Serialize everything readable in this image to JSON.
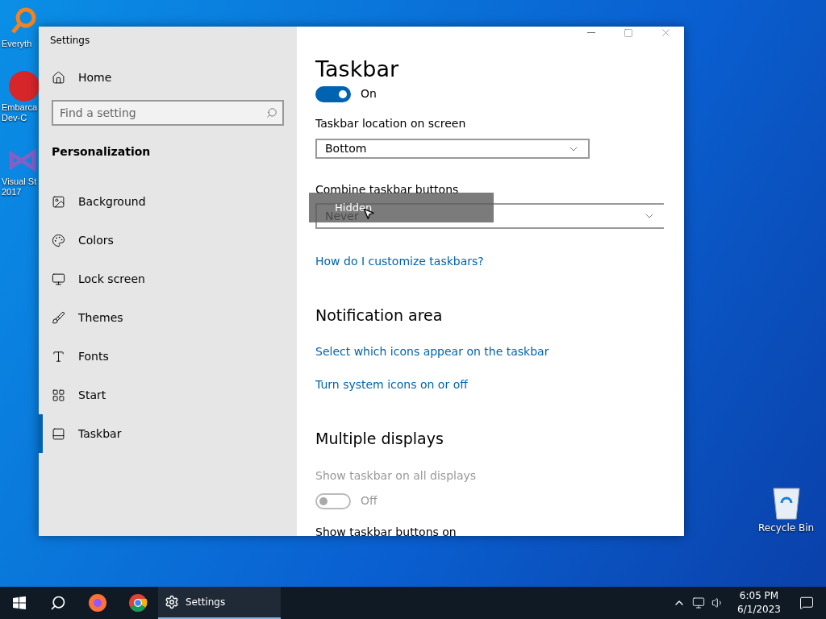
{
  "desktop_icons": [
    {
      "label": "Everyth",
      "kind": "search"
    },
    {
      "label": "Embarca\nDev-C",
      "kind": "dev"
    },
    {
      "label": "Visual St\n2017",
      "kind": "vs"
    }
  ],
  "recycle_bin": {
    "label": "Recycle Bin"
  },
  "window": {
    "title": "Settings"
  },
  "sidebar": {
    "home": "Home",
    "search": {
      "placeholder": "Find a setting"
    },
    "section": "Personalization",
    "items": [
      {
        "label": "Background",
        "selected": false
      },
      {
        "label": "Colors",
        "selected": false
      },
      {
        "label": "Lock screen",
        "selected": false
      },
      {
        "label": "Themes",
        "selected": false
      },
      {
        "label": "Fonts",
        "selected": false
      },
      {
        "label": "Start",
        "selected": false
      },
      {
        "label": "Taskbar",
        "selected": true
      }
    ]
  },
  "content": {
    "title": "Taskbar",
    "toggle": {
      "on": true,
      "label": "On"
    },
    "location": {
      "label": "Taskbar location on screen",
      "value": "Bottom"
    },
    "combine": {
      "label": "Combine taskbar buttons",
      "value": "Never",
      "drag_label": "Hidden"
    },
    "link": "How do I customize taskbars?",
    "notification": {
      "heading": "Notification area",
      "links": [
        "Select which icons appear on the taskbar",
        "Turn system icons on or off"
      ]
    },
    "multiple": {
      "heading": "Multiple displays",
      "setting": {
        "label": "Show taskbar on all displays",
        "disabled": true,
        "on": false,
        "state": "Off"
      },
      "next_label": "Show taskbar buttons on"
    }
  },
  "taskbar": {
    "app": "Settings",
    "time": "6:05 PM",
    "date": "6/1/2023"
  }
}
